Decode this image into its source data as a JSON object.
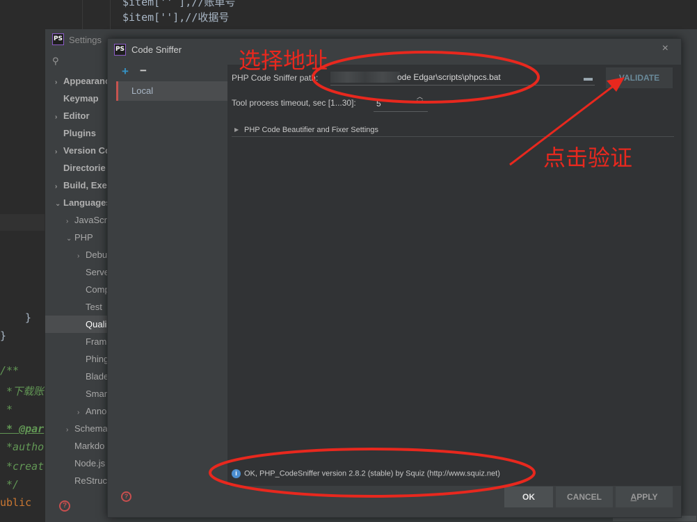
{
  "editor": {
    "lines": [
      {
        "text": "$item[''],//收据号",
        "kind": "var"
      },
      {
        "text": "}",
        "kind": "var"
      },
      {
        "text": "}",
        "kind": "var"
      },
      {
        "text": "/**",
        "kind": "comment"
      },
      {
        "text": " *下载账",
        "kind": "comment"
      },
      {
        "text": " *",
        "kind": "comment"
      },
      {
        "text": " * @par",
        "kind": "tag"
      },
      {
        "text": " *autho",
        "kind": "comment"
      },
      {
        "text": " *creat",
        "kind": "comment"
      },
      {
        "text": " */",
        "kind": "comment"
      },
      {
        "text": "ublic",
        "kind": "kw"
      }
    ]
  },
  "settings": {
    "title": "Settings",
    "logo": "PS",
    "search_icon": "search-icon",
    "tree": [
      {
        "label": "Appearanc",
        "level": 0,
        "arrow": "›",
        "bold": true
      },
      {
        "label": "Keymap",
        "level": 0,
        "arrow": "",
        "bold": true
      },
      {
        "label": "Editor",
        "level": 0,
        "arrow": "›",
        "bold": true
      },
      {
        "label": "Plugins",
        "level": 0,
        "arrow": "",
        "bold": true
      },
      {
        "label": "Version Co",
        "level": 0,
        "arrow": "›",
        "bold": true
      },
      {
        "label": "Directorie",
        "level": 0,
        "arrow": "",
        "bold": true
      },
      {
        "label": "Build, Exec",
        "level": 0,
        "arrow": "›",
        "bold": true
      },
      {
        "label": "Languages",
        "level": 0,
        "arrow": "⌄",
        "bold": true
      },
      {
        "label": "JavaScri",
        "level": 1,
        "arrow": "›",
        "bold": false
      },
      {
        "label": "PHP",
        "level": 1,
        "arrow": "⌄",
        "bold": false
      },
      {
        "label": "Debu",
        "level": 2,
        "arrow": "›",
        "bold": false
      },
      {
        "label": "Serve",
        "level": 2,
        "arrow": "",
        "bold": false
      },
      {
        "label": "Comp",
        "level": 2,
        "arrow": "",
        "bold": false
      },
      {
        "label": "Test",
        "level": 2,
        "arrow": "",
        "bold": false
      },
      {
        "label": "Quali",
        "level": 2,
        "arrow": "",
        "bold": false,
        "selected": true
      },
      {
        "label": "Fram",
        "level": 2,
        "arrow": "",
        "bold": false
      },
      {
        "label": "Phing",
        "level": 2,
        "arrow": "",
        "bold": false
      },
      {
        "label": "Blade",
        "level": 2,
        "arrow": "",
        "bold": false
      },
      {
        "label": "Smar",
        "level": 2,
        "arrow": "",
        "bold": false
      },
      {
        "label": "Anno",
        "level": 2,
        "arrow": "›",
        "bold": false
      },
      {
        "label": "Schema",
        "level": 1,
        "arrow": "›",
        "bold": false
      },
      {
        "label": "Markdo",
        "level": 1,
        "arrow": "",
        "bold": false
      },
      {
        "label": "Node.js",
        "level": 1,
        "arrow": "",
        "bold": false
      },
      {
        "label": "ReStruct",
        "level": 1,
        "arrow": "",
        "bold": false
      }
    ]
  },
  "dialog": {
    "title": "Code Sniffer",
    "logo": "PS",
    "close": "×",
    "add": "+",
    "remove": "−",
    "profiles": [
      "Local"
    ],
    "path_label": "PHP Code Sniffer path:",
    "path_value": "ode Edgar\\scripts\\phpcs.bat",
    "validate_label": "VALIDATE",
    "timeout_label": "Tool process timeout, sec [1...30]:",
    "timeout_value": "5",
    "beautifier_label": "PHP Code Beautifier and Fixer Settings",
    "status_text": "OK, PHP_CodeSniffer version 2.8.2 (stable) by Squiz (http://www.squiz.net)",
    "help": "?",
    "ok_label": "OK",
    "cancel_label": "CANCEL",
    "apply_first": "A",
    "apply_rest": "PPLY"
  },
  "annotations": {
    "select_address": "选择地址",
    "click_validate": "点击验证",
    "color": "#e8281e"
  }
}
